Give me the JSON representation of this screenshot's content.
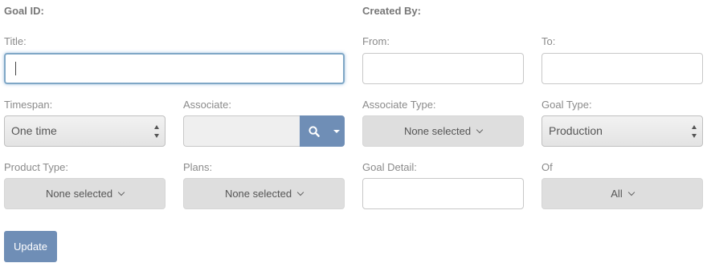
{
  "header": {
    "goal_id_label": "Goal ID:",
    "created_by_label": "Created By:"
  },
  "form": {
    "title_label": "Title:",
    "title_value": "",
    "from_label": "From:",
    "from_value": "",
    "to_label": "To:",
    "to_value": "",
    "timespan_label": "Timespan:",
    "timespan_value": "One time",
    "associate_label": "Associate:",
    "associate_value": "",
    "associate_type_label": "Associate Type:",
    "associate_type_value": "None selected",
    "goal_type_label": "Goal Type:",
    "goal_type_value": "Production",
    "product_type_label": "Product Type:",
    "product_type_value": "None selected",
    "plans_label": "Plans:",
    "plans_value": "None selected",
    "goal_detail_label": "Goal Detail:",
    "goal_detail_value": "",
    "of_label": "Of",
    "of_value": "All"
  },
  "actions": {
    "update_label": "Update"
  },
  "colors": {
    "accent": "#6f8eb6",
    "focus_ring": "#7fa7c6"
  },
  "icons": {
    "search": "search-icon",
    "dropdown": "caret-down-icon",
    "chevron": "chevron-down-icon",
    "updown": "updown-arrows-icon"
  }
}
